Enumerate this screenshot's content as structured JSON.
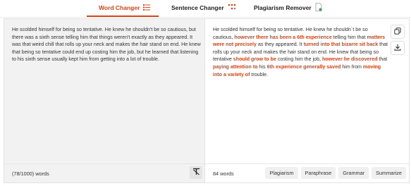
{
  "tabs": [
    {
      "label": "Word Changer",
      "icon": "list-icon",
      "active": true
    },
    {
      "label": "Sentence Changer",
      "icon": "dots-icon",
      "active": false
    },
    {
      "label": "Plagiarism Remover",
      "icon": "document-icon",
      "active": false
    }
  ],
  "input": {
    "text": "He scolded himself for being so tentative. He knew he shouldn't be so cautious, but there was a sixth sense telling him that things weren't exactly as they appeared. It was that weird chill that rolls up your neck and makes the hair stand on end. He knew that being so tentative could end up costing him the job, but he learned that listening to his sixth sense usually kept him from getting into a lot of trouble.",
    "word_count": "(78/1000) words"
  },
  "output": {
    "segments": [
      {
        "t": "He scolded himself for being so tentative. He knew he shouldn`t be so cautious, ",
        "h": false
      },
      {
        "t": "however there has been a 6th experience",
        "h": true
      },
      {
        "t": " telling him that ",
        "h": false
      },
      {
        "t": "matters were not precisely",
        "h": true
      },
      {
        "t": " as they appeared. It ",
        "h": false
      },
      {
        "t": "turned into that bizarre sit back",
        "h": true
      },
      {
        "t": " that rolls up your neck and makes the hair stand on end. He knew that being so tentative ",
        "h": false
      },
      {
        "t": "should grow to be",
        "h": true
      },
      {
        "t": " costing him the job, ",
        "h": false
      },
      {
        "t": "however he discovered",
        "h": true
      },
      {
        "t": " that ",
        "h": false
      },
      {
        "t": "paying attention to",
        "h": true
      },
      {
        "t": " his ",
        "h": false
      },
      {
        "t": "6th experience generally saved",
        "h": true
      },
      {
        "t": " him from ",
        "h": false
      },
      {
        "t": "moving into a variety of",
        "h": true
      },
      {
        "t": " trouble.",
        "h": false
      }
    ],
    "word_count": "84 words",
    "actions": [
      "Plagiarism",
      "Paraphrase",
      "Grammar",
      "Summarize"
    ]
  },
  "colors": {
    "accent": "#d6451b"
  }
}
